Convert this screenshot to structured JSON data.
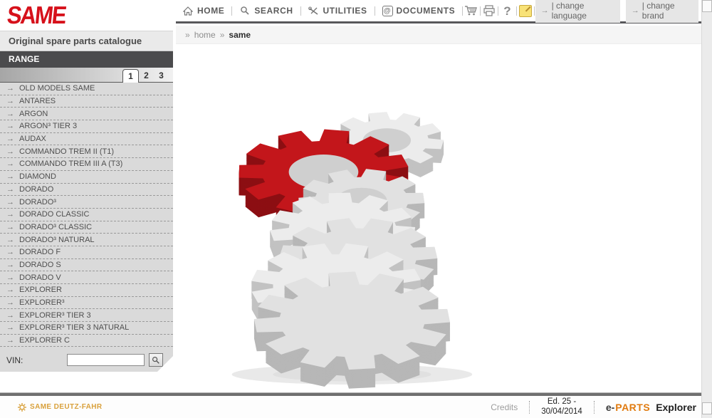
{
  "brand": {
    "logo_text": "SAME"
  },
  "nav": {
    "items": [
      {
        "label": "HOME"
      },
      {
        "label": "SEARCH"
      },
      {
        "label": "UTILITIES"
      },
      {
        "label": "DOCUMENTS"
      }
    ],
    "help_glyph": "?"
  },
  "top_actions": [
    {
      "label": "| change language"
    },
    {
      "label": "| change brand"
    }
  ],
  "icons": {
    "item_arrow": "→",
    "action_arrow": "→",
    "breadcrumb_sep": "»",
    "documents_glyph": "@"
  },
  "breadcrumb": {
    "home": "home",
    "current": "same"
  },
  "sidebar": {
    "subtitle": "Original spare parts catalogue",
    "range_label": "RANGE",
    "tabs": [
      "1",
      "2",
      "3"
    ],
    "active_tab": "1",
    "items": [
      "OLD MODELS SAME",
      "ANTARES",
      "ARGON",
      "ARGON³ TIER 3",
      "AUDAX",
      "COMMANDO TREM II (T1)",
      "COMMANDO TREM III A (T3)",
      "DIAMOND",
      "DORADO",
      "DORADO³",
      "DORADO CLASSIC",
      "DORADO³ CLASSIC",
      "DORADO³ NATURAL",
      "DORADO F",
      "DORADO S",
      "DORADO V",
      "EXPLORER",
      "EXPLORER³",
      "EXPLORER³ TIER 3",
      "EXPLORER³ TIER 3 NATURAL",
      "EXPLORER C"
    ],
    "vin_label": "VIN:",
    "vin_value": ""
  },
  "footer": {
    "brand": "SAME DEUTZ-FAHR",
    "credits": "Credits",
    "edition_line1": "Ed. 25 -",
    "edition_line2": "30/04/2014",
    "eparts_e": "e-",
    "eparts_parts": "PARTS",
    "eparts_suffix": "Explorer"
  },
  "illustration": {
    "grey_top_a": "#ececec",
    "grey_side_a": "#c2c2c2",
    "grey_top_b": "#e1e1e1",
    "grey_side_b": "#b7b7b7",
    "red_top": "#c3161b",
    "red_side": "#8c0f13",
    "hole_fill": "#cfcfcf",
    "shadow": "#e9e9e9"
  }
}
